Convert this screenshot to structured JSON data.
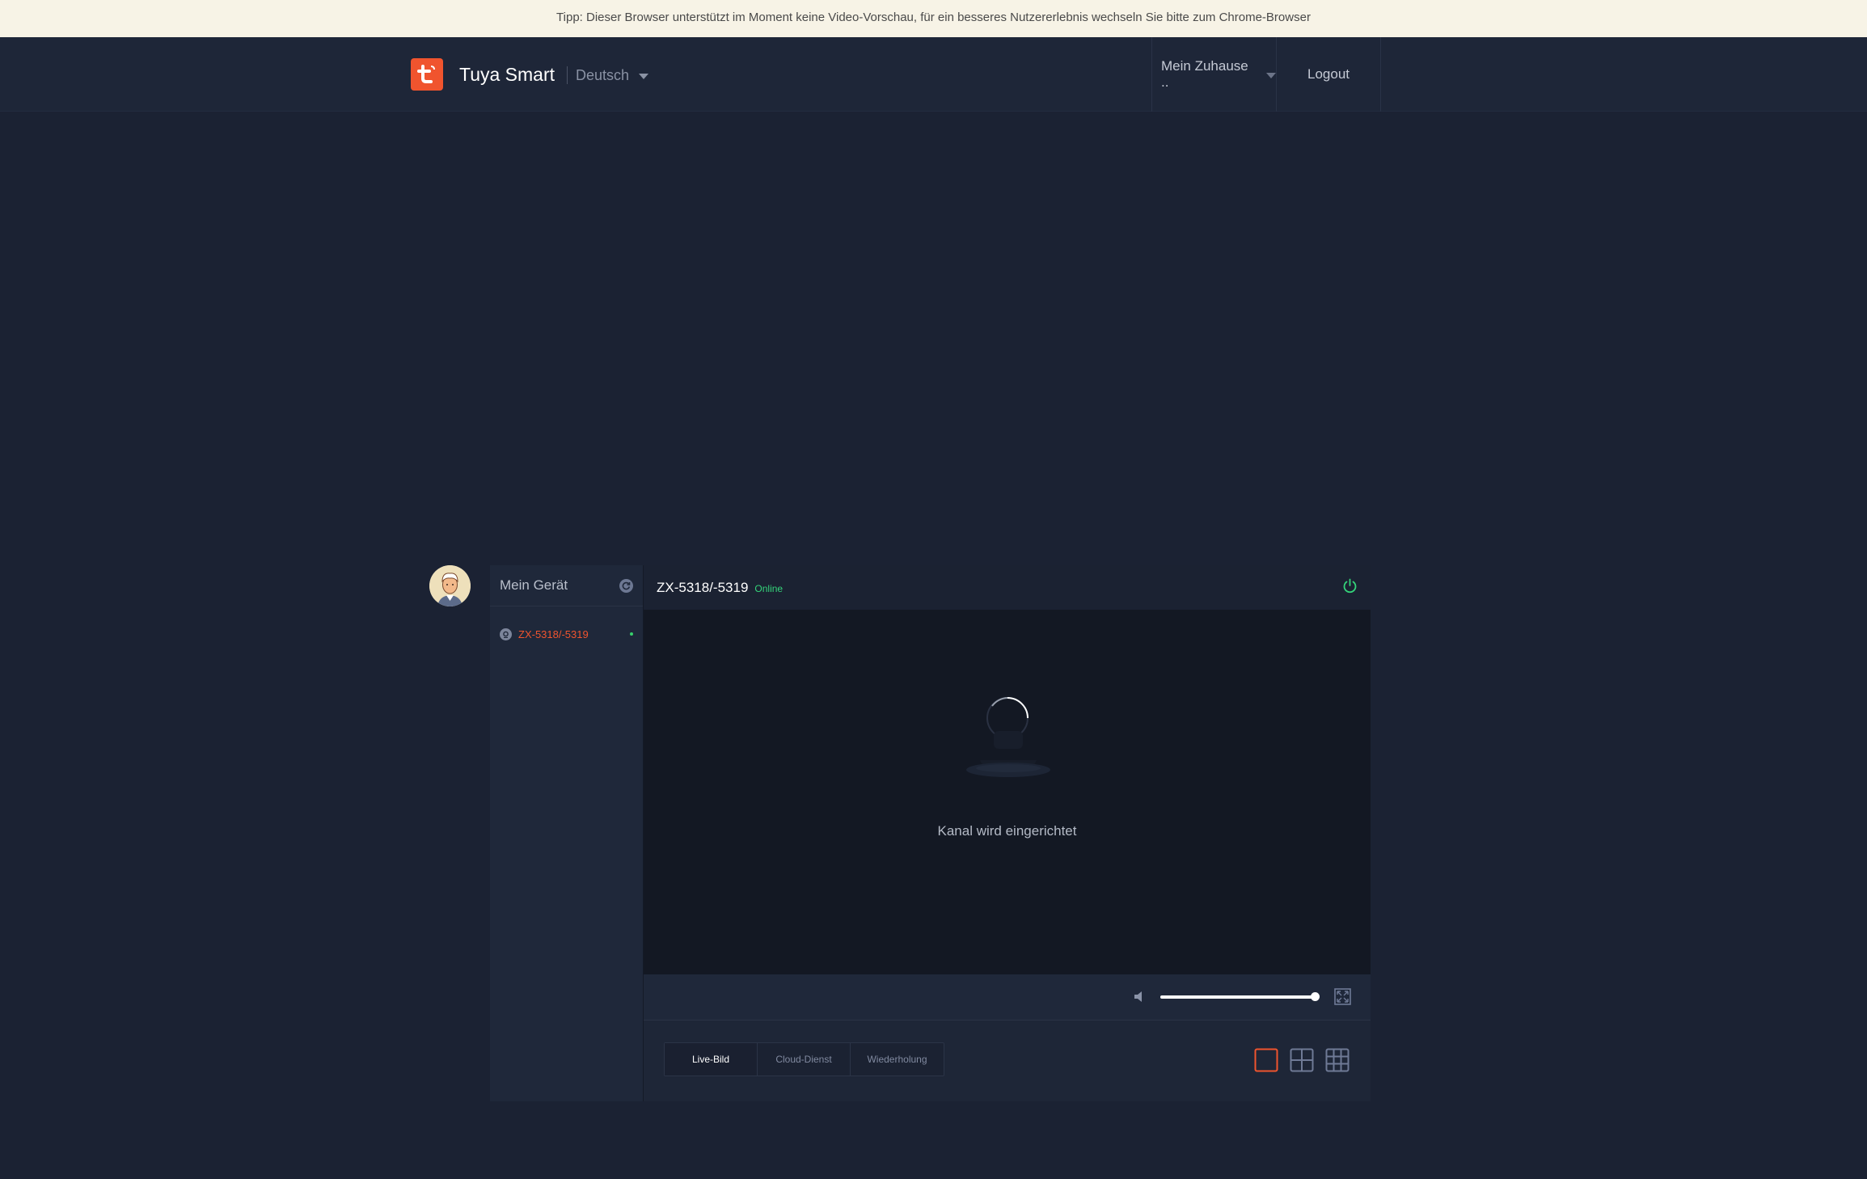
{
  "tip": {
    "text": "Tipp: Dieser Browser unterstützt im Moment keine Video-Vorschau, für ein besseres Nutzererlebnis wechseln Sie bitte zum Chrome-Browser"
  },
  "header": {
    "brand": "Tuya Smart",
    "language": "Deutsch",
    "home_select": "Mein Zuhause ..",
    "logout": "Logout"
  },
  "sidebar": {
    "title": "Mein Gerät",
    "devices": [
      {
        "name": "ZX-5318/-5319",
        "online": true
      }
    ]
  },
  "player": {
    "device_title": "ZX-5318/-5319",
    "status": "Online",
    "loading_text": "Kanal wird eingerichtet",
    "volume_percent": 100
  },
  "tabs": [
    {
      "label": "Live-Bild",
      "active": true
    },
    {
      "label": "Cloud-Dienst",
      "active": false
    },
    {
      "label": "Wiederholung",
      "active": false
    }
  ],
  "colors": {
    "accent": "#f0542e",
    "online": "#34d47a",
    "background": "#1b2233"
  }
}
